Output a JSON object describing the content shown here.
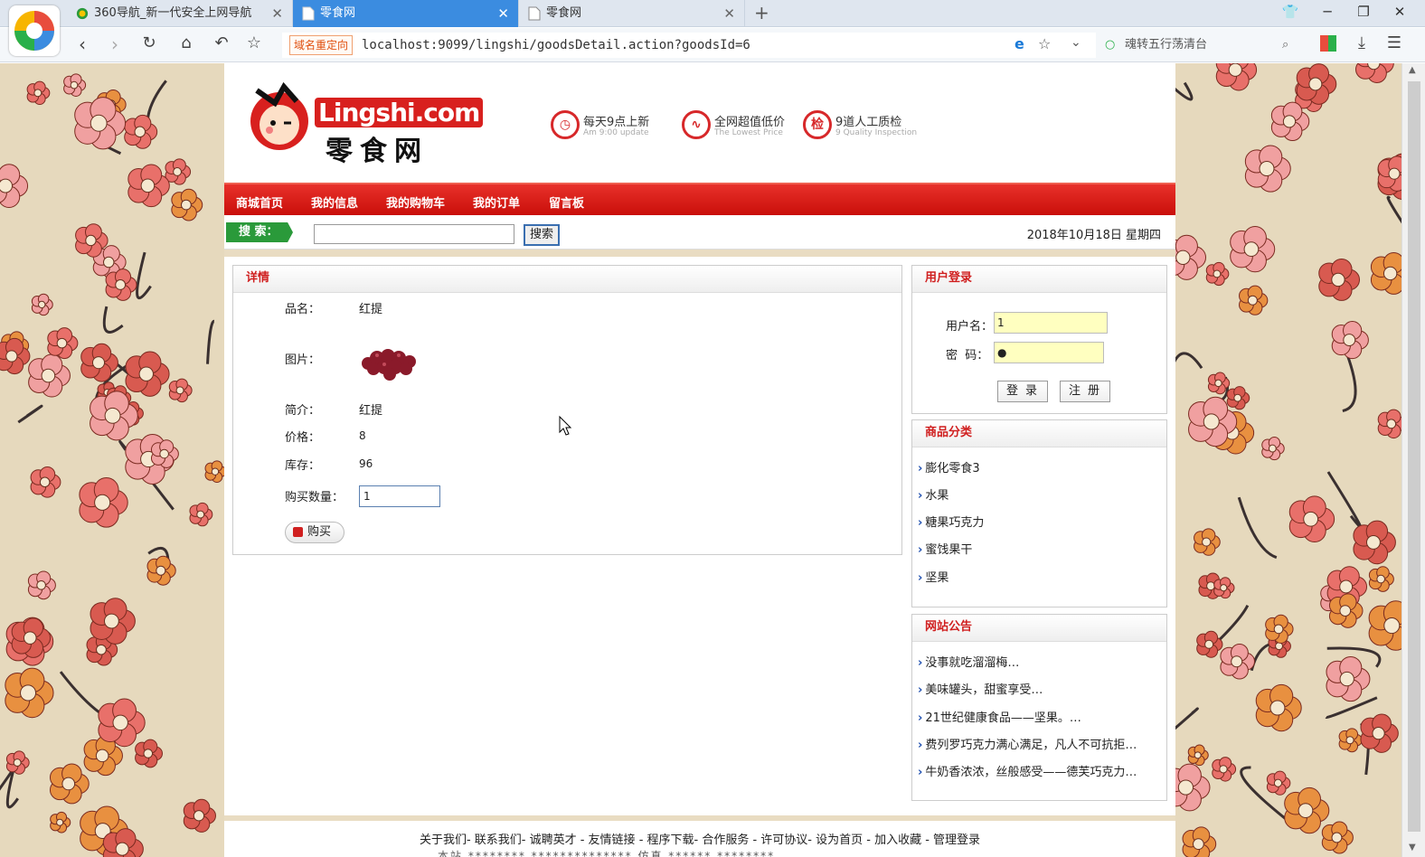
{
  "browser": {
    "tabs": [
      {
        "label": "360导航_新一代安全上网导航",
        "active": false
      },
      {
        "label": "零食网",
        "active": true
      },
      {
        "label": "零食网",
        "active": false
      }
    ],
    "redirect_badge": "域名重定向",
    "url": "localhost:9099/lingshi/goodsDetail.action?goodsId=6",
    "search_placeholder": "魂转五行荡清台"
  },
  "header": {
    "logo_en": "Lingshi.com",
    "logo_cn": "零食网",
    "features": [
      {
        "icon": "clock-icon",
        "title": "每天9点上新",
        "subtitle": "Am 9:00 update"
      },
      {
        "icon": "price-down-icon",
        "title": "全网超值低价",
        "subtitle": "The Lowest Price"
      },
      {
        "icon": "inspect-icon",
        "icon_text": "检",
        "title": "9道人工质检",
        "subtitle": "9 Quality Inspection"
      }
    ]
  },
  "menu": [
    "商城首页",
    "我的信息",
    "我的购物车",
    "我的订单",
    "留言板"
  ],
  "search": {
    "label": "搜 索：",
    "button": "搜索",
    "value": ""
  },
  "date": "2018年10月18日 星期四",
  "detail": {
    "title": "详情",
    "rows": [
      {
        "label": "品名：",
        "value": "红提"
      },
      {
        "label": "图片：",
        "value": ""
      },
      {
        "label": "简介：",
        "value": "红提"
      },
      {
        "label": "价格：",
        "value": "8"
      },
      {
        "label": "库存：",
        "value": "96"
      }
    ],
    "qty_label": "购买数量：",
    "qty_value": "1",
    "buy_button": "购买"
  },
  "login": {
    "title": "用户登录",
    "username_label": "用户名：",
    "username_value": "1",
    "password_label": "密  码：",
    "password_value": "●",
    "login_button": "登录",
    "register_button": "注册"
  },
  "category": {
    "title": "商品分类",
    "items": [
      "膨化零食3",
      "水果",
      "糖果巧克力",
      "蜜饯果干",
      "坚果"
    ]
  },
  "notice": {
    "title": "网站公告",
    "items": [
      "没事就吃溜溜梅…",
      "美味罐头，甜蜜享受…",
      "21世纪健康食品——坚果。…",
      "费列罗巧克力满心满足，凡人不可抗拒…",
      "牛奶香浓浓，丝般感受——德芙巧克力…"
    ]
  },
  "footer": {
    "links": "关于我们- 联系我们- 诚聘英才 - 友情链接 - 程序下载- 合作服务 - 许可协议- 设为首页 - 加入收藏 - 管理登录",
    "line2": "本站 ******** ************** 仿真 ****** ********"
  }
}
